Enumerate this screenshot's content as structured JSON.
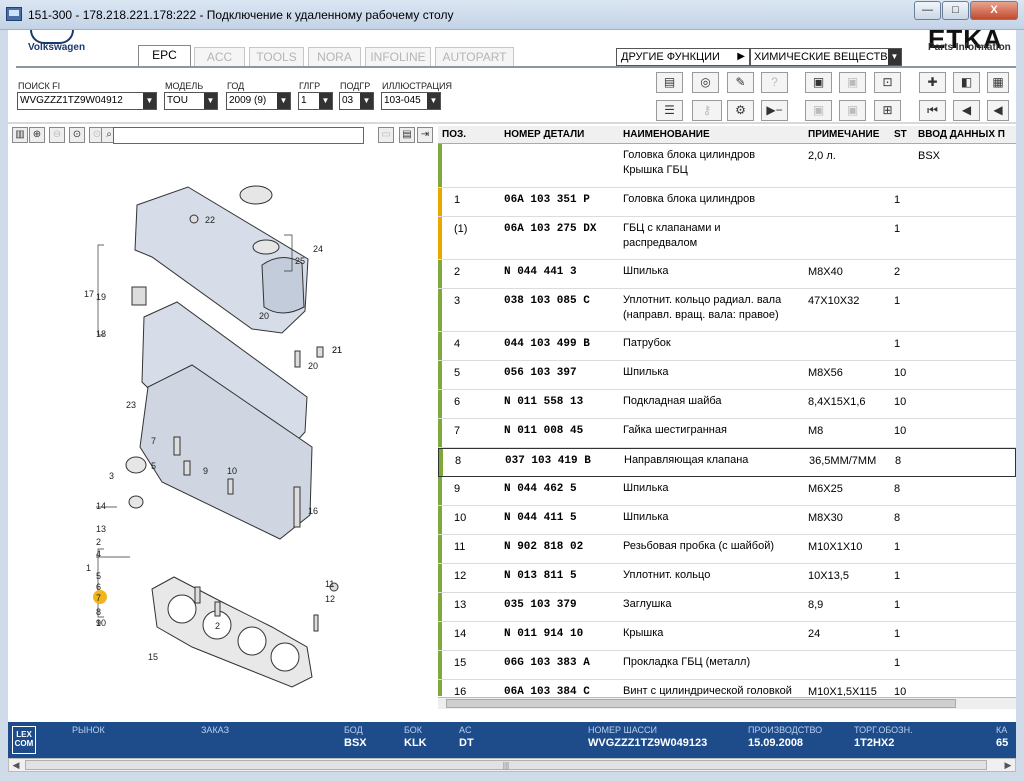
{
  "window": {
    "title": "151-300 - 178.218.221.178:222 - Подключение к удаленному рабочему столу",
    "min": "—",
    "max": "□",
    "close": "X"
  },
  "header": {
    "brand": "Volkswagen",
    "logo_text": "ETKA",
    "parts_info": "Parts Information",
    "tabs": [
      "EPC",
      "ACC",
      "TOOLS",
      "NORA",
      "INFOLINE",
      "AUTOPART"
    ],
    "active_tab": "EPC",
    "other_functions": "ДРУГИЕ ФУНКЦИИ",
    "chem_select": "ХИМИЧЕСКИЕ ВЕЩЕСТВ"
  },
  "filters": {
    "search_fi": {
      "label": "ПОИСК FI",
      "value": "WVGZZZ1TZ9W04912"
    },
    "model": {
      "label": "МОДЕЛЬ",
      "value": "TOU"
    },
    "year": {
      "label": "ГОД",
      "value": "2009 (9)"
    },
    "hg": {
      "label": "ГЛГР",
      "value": "1"
    },
    "sg": {
      "label": "ПОДГР",
      "value": "03"
    },
    "illustration": {
      "label": "ИЛЛЮСТРАЦИЯ",
      "value": "103-045"
    }
  },
  "toolbar_icons": [
    "print-icon",
    "disk-icon",
    "tools-icon",
    "help-icon",
    "elsa-icon",
    "depot-icon",
    "cart-in-icon",
    "pin-icon",
    "prev-page-icon",
    "next-page-icon",
    "list-icon",
    "key-icon",
    "bike-icon",
    "play-minus-icon",
    "elsa2-icon",
    "depot2-icon",
    "cart-icon",
    "first-icon",
    "back-icon",
    "forward-icon"
  ],
  "table": {
    "headers": {
      "pos": "ПОЗ.",
      "part": "НОМЕР ДЕТАЛИ",
      "name": "НАИМЕНОВАНИЕ",
      "note": "ПРИМЕЧАНИЕ",
      "st": "ST",
      "input": "ВВОД ДАННЫХ П"
    },
    "rows": [
      {
        "pos": "",
        "part": "",
        "name": "Головка блока цилиндров",
        "name2": "Крышка ГБЦ",
        "note": "2,0 л.",
        "st": "",
        "input": "BSX",
        "mark": "#7ea83a"
      },
      {
        "pos": "1",
        "part": "06A 103 351 P",
        "name": "Головка блока цилиндров",
        "name2": "",
        "note": "",
        "st": "1",
        "input": "",
        "mark": "#e8a800"
      },
      {
        "pos": "(1)",
        "part": "06A 103 275 DX",
        "name": "ГБЦ с клапанами и",
        "name2": "распредвалом",
        "note": "",
        "st": "1",
        "input": "",
        "mark": "#e8a800"
      },
      {
        "pos": "2",
        "part": "N 044 441 3",
        "name": "Шпилька",
        "name2": "",
        "note": "M8X40",
        "st": "2",
        "input": "",
        "mark": "#7ea83a"
      },
      {
        "pos": "3",
        "part": "038 103 085 C",
        "name": "Уплотнит. кольцо радиал. вала",
        "name2": "(направл. вращ. вала: правое)",
        "note": "47X10X32",
        "st": "1",
        "input": "",
        "mark": "#7ea83a"
      },
      {
        "pos": "4",
        "part": "044 103 499 B",
        "name": "Патрубок",
        "name2": "",
        "note": "",
        "st": "1",
        "input": "",
        "mark": "#7ea83a"
      },
      {
        "pos": "5",
        "part": "056 103 397",
        "name": "Шпилька",
        "name2": "",
        "note": "M8X56",
        "st": "10",
        "input": "",
        "mark": "#7ea83a"
      },
      {
        "pos": "6",
        "part": "N 011 558 13",
        "name": "Подкладная шайба",
        "name2": "",
        "note": "8,4X15X1,6",
        "st": "10",
        "input": "",
        "mark": "#7ea83a"
      },
      {
        "pos": "7",
        "part": "N 011 008 45",
        "name": "Гайка шестигранная",
        "name2": "",
        "note": "M8",
        "st": "10",
        "input": "",
        "mark": "#7ea83a"
      },
      {
        "pos": "8",
        "part": "037 103 419 B",
        "name": "Направляющая клапана",
        "name2": "",
        "note": "36,5MM/7MM",
        "st": "8",
        "input": "",
        "mark": "#7ea83a",
        "selected": true
      },
      {
        "pos": "9",
        "part": "N 044 462 5",
        "name": "Шпилька",
        "name2": "",
        "note": "M6X25",
        "st": "8",
        "input": "",
        "mark": "#7ea83a"
      },
      {
        "pos": "10",
        "part": "N 044 411 5",
        "name": "Шпилька",
        "name2": "",
        "note": "M8X30",
        "st": "8",
        "input": "",
        "mark": "#7ea83a"
      },
      {
        "pos": "11",
        "part": "N 902 818 02",
        "name": "Резьбовая пробка (с шайбой)",
        "name2": "",
        "note": "M10X1X10",
        "st": "1",
        "input": "",
        "mark": "#7ea83a"
      },
      {
        "pos": "12",
        "part": "N 013 811 5",
        "name": "Уплотнит. кольцо",
        "name2": "",
        "note": "10X13,5",
        "st": "1",
        "input": "",
        "mark": "#7ea83a"
      },
      {
        "pos": "13",
        "part": "035 103 379",
        "name": "Заглушка",
        "name2": "",
        "note": "8,9",
        "st": "1",
        "input": "",
        "mark": "#7ea83a"
      },
      {
        "pos": "14",
        "part": "N 011 914 10",
        "name": "Крышка",
        "name2": "",
        "note": "24",
        "st": "1",
        "input": "",
        "mark": "#7ea83a"
      },
      {
        "pos": "15",
        "part": "06G 103 383 A",
        "name": "Прокладка ГБЦ (металл)",
        "name2": "",
        "note": "",
        "st": "1",
        "input": "",
        "mark": "#7ea83a"
      },
      {
        "pos": "16",
        "part": "06A 103 384 C",
        "name": "Винт с цилиндрической головкой",
        "name2": "",
        "note": "M10X1,5X115",
        "st": "10",
        "input": "",
        "mark": "#7ea83a"
      }
    ]
  },
  "illustration_labels": [
    "22",
    "24",
    "25",
    "20",
    "21",
    "17",
    "19",
    "18",
    "21",
    "20",
    "23",
    "7",
    "5",
    "9",
    "3",
    "10",
    "14",
    "16",
    "13",
    "2",
    "4",
    "1",
    "5",
    "6",
    "7",
    "8",
    "9",
    "10",
    "11",
    "12",
    "2",
    "15"
  ],
  "status": {
    "lexcom": "LEX COM",
    "market_label": "РЫНОК",
    "market_value": "",
    "order_label": "ЗАКАЗ",
    "order_value": "",
    "bod_label": "БОД",
    "bod_value": "BSX",
    "bok_label": "БОК",
    "bok_value": "KLK",
    "ac_label": "AC",
    "ac_value": "DT",
    "chassis_label": "НОМЕР ШАССИ",
    "chassis_value": "WVGZZZ1TZ9W049123",
    "prod_label": "ПРОИЗВОДСТВО",
    "prod_value": "15.09.2008",
    "trade_label": "ТОРГ.ОБОЗН.",
    "trade_value": "1T2HX2",
    "last_label": "КА",
    "last_value": "65"
  },
  "colors": {
    "status_bar": "#1e4c8a",
    "green_mark": "#7ea83a",
    "orange_mark": "#e8a800",
    "highlight": "#f2b51b"
  }
}
